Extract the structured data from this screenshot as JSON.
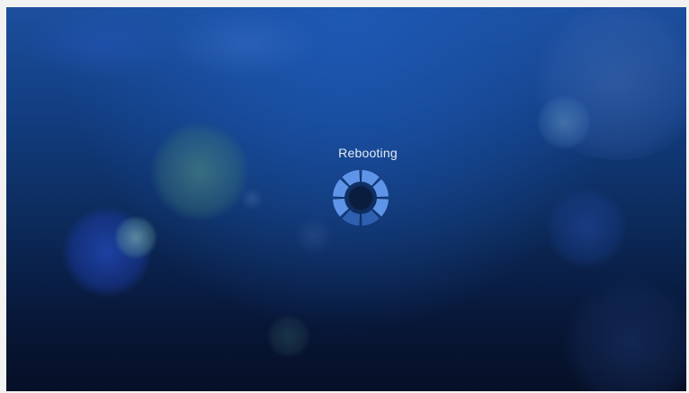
{
  "status": {
    "label": "Rebooting"
  },
  "spinner": {
    "icon": "loading-spinner-icon",
    "segments": 8,
    "active_color": "#5f95e8",
    "dim_color": "#2f5fb0"
  },
  "background": {
    "top_color": "#1c4f9e",
    "bottom_color": "#060f26"
  }
}
